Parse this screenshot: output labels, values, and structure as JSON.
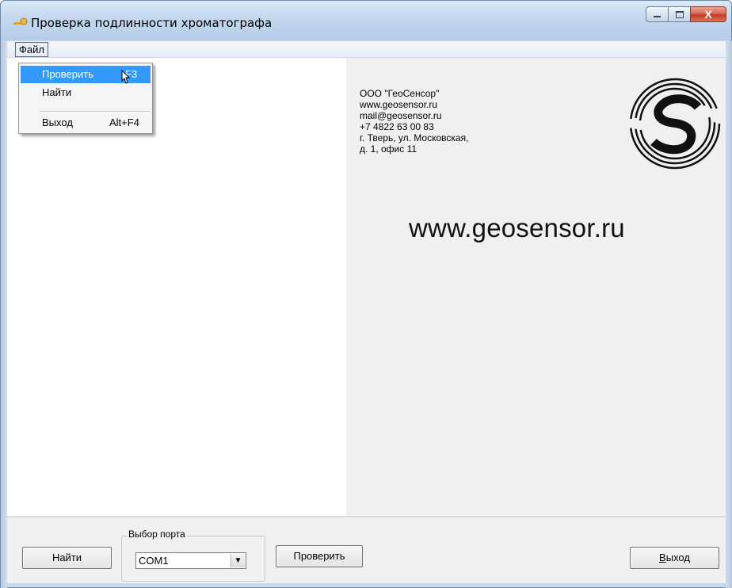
{
  "window": {
    "title": "Проверка подлинности хроматографа",
    "buttons": {
      "minimize": "—",
      "maximize": "□",
      "close": "X"
    }
  },
  "menubar": {
    "file": "Файл"
  },
  "file_menu": {
    "items": [
      {
        "label": "Проверить",
        "shortcut": "F3",
        "highlighted": true
      },
      {
        "label": "Найти",
        "shortcut": ""
      },
      {
        "label": "Выход",
        "shortcut": "Alt+F4"
      }
    ]
  },
  "info": {
    "company": "ООО \"ГеоСенсор\"",
    "site": "www.geosensor.ru",
    "email": "mail@geosensor.ru",
    "phone": "+7 4822 63 00 83",
    "address_1": "г. Тверь, ул. Московская,",
    "address_2": "д. 1, офис 11",
    "big_url": "www.geosensor.ru",
    "logo_icon": "geosensor-logo"
  },
  "bottom": {
    "find_button": "Найти",
    "port_group_label": "Выбор порта",
    "port_value": "COM1",
    "check_button": "Проверить",
    "exit_button": "Выход"
  },
  "colors": {
    "highlight": "#3399ff",
    "panel": "#f0f0f0"
  }
}
